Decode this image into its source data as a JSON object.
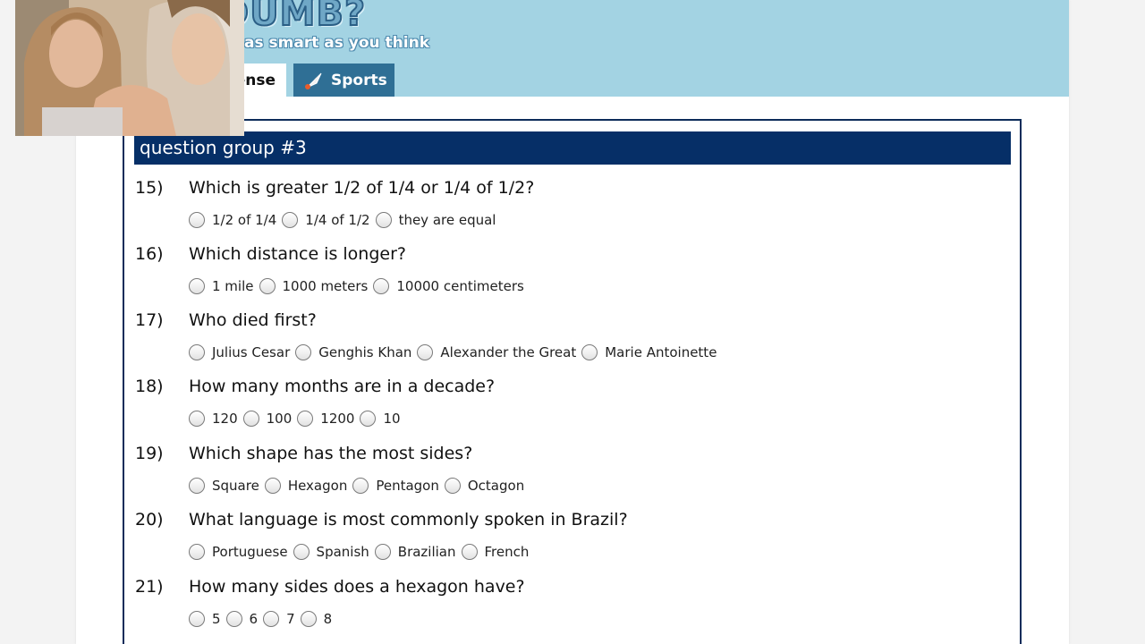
{
  "header": {
    "logo_title": "DUMB?",
    "tagline": "as smart as you think",
    "tabs": [
      {
        "label": "ense"
      },
      {
        "label": "Sports"
      }
    ]
  },
  "quiz": {
    "group_title": "question group #3",
    "questions": [
      {
        "number": "15)",
        "text": "Which is greater 1/2 of 1/4 or 1/4 of 1/2?",
        "options": [
          "1/2 of 1/4",
          "1/4 of 1/2",
          "they are equal"
        ]
      },
      {
        "number": "16)",
        "text": "Which distance is longer?",
        "options": [
          "1 mile",
          "1000 meters",
          "10000 centimeters"
        ]
      },
      {
        "number": "17)",
        "text": "Who died first?",
        "options": [
          "Julius Cesar",
          "Genghis Khan",
          "Alexander the Great",
          "Marie Antoinette"
        ]
      },
      {
        "number": "18)",
        "text": "How many months are in a decade?",
        "options": [
          "120",
          "100",
          "1200",
          "10"
        ]
      },
      {
        "number": "19)",
        "text": "Which shape has the most sides?",
        "options": [
          "Square",
          "Hexagon",
          "Pentagon",
          "Octagon"
        ]
      },
      {
        "number": "20)",
        "text": "What language is most commonly spoken in Brazil?",
        "options": [
          "Portuguese",
          "Spanish",
          "Brazilian",
          "French"
        ]
      },
      {
        "number": "21)",
        "text": "How many sides does a hexagon have?",
        "options": [
          "5",
          "6",
          "7",
          "8"
        ]
      }
    ]
  },
  "colors": {
    "banner": "#a3d3e3",
    "tab_active": "#2f6f95",
    "group_header": "#062f67",
    "quiz_border": "#0d2c5a"
  },
  "icons": {
    "sports_tab": "badminton-shuttlecock-icon"
  }
}
